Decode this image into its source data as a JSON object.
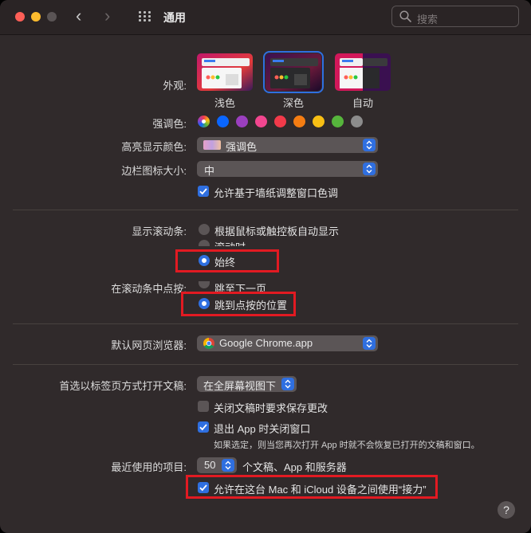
{
  "window": {
    "title": "通用"
  },
  "search": {
    "placeholder": "搜索"
  },
  "appearance": {
    "label": "外观:",
    "options": [
      {
        "name": "浅色",
        "selected": false
      },
      {
        "name": "深色",
        "selected": true
      },
      {
        "name": "自动",
        "selected": false
      }
    ]
  },
  "accent": {
    "label": "强调色:",
    "colors": [
      "#multicolor",
      "#0a66ff",
      "#9b3fbf",
      "#f2468f",
      "#f23a4a",
      "#f57d12",
      "#f8bf14",
      "#56b53c",
      "#8c8c8c"
    ]
  },
  "highlight": {
    "label": "高亮显示颜色:",
    "value": "强调色"
  },
  "sidebar_icon": {
    "label": "边栏图标大小:",
    "value": "中"
  },
  "wallpaper_tint": {
    "label": "允许基于墙纸调整窗口色调",
    "checked": true
  },
  "scrollbars": {
    "label": "显示滚动条:",
    "options": [
      {
        "text": "根据鼠标或触控板自动显示",
        "selected": false
      },
      {
        "text": "滚动时",
        "selected": false
      },
      {
        "text": "始终",
        "selected": true
      }
    ]
  },
  "scroll_click": {
    "label": "在滚动条中点按:",
    "options": [
      {
        "text": "跳至下一页",
        "selected": false
      },
      {
        "text": "跳到点按的位置",
        "selected": true
      }
    ]
  },
  "browser": {
    "label": "默认网页浏览器:",
    "value": "Google Chrome.app"
  },
  "tabs": {
    "label": "首选以标签页方式打开文稿:",
    "value": "在全屏幕视图下"
  },
  "ask_save": {
    "label": "关闭文稿时要求保存更改",
    "checked": false
  },
  "close_windows": {
    "label": "退出 App 时关闭窗口",
    "checked": true,
    "note": "如果选定，则当您再次打开 App 时就不会恢复已打开的文稿和窗口。"
  },
  "recent": {
    "label": "最近使用的项目:",
    "value": "50",
    "suffix": "个文稿、App 和服务器"
  },
  "handoff": {
    "label": "允许在这台 Mac 和 iCloud 设备之间使用“接力”",
    "checked": true
  },
  "help": {
    "label": "?"
  },
  "colors": {
    "accent": "#2f6fe0",
    "annotation": "#e21a22"
  }
}
